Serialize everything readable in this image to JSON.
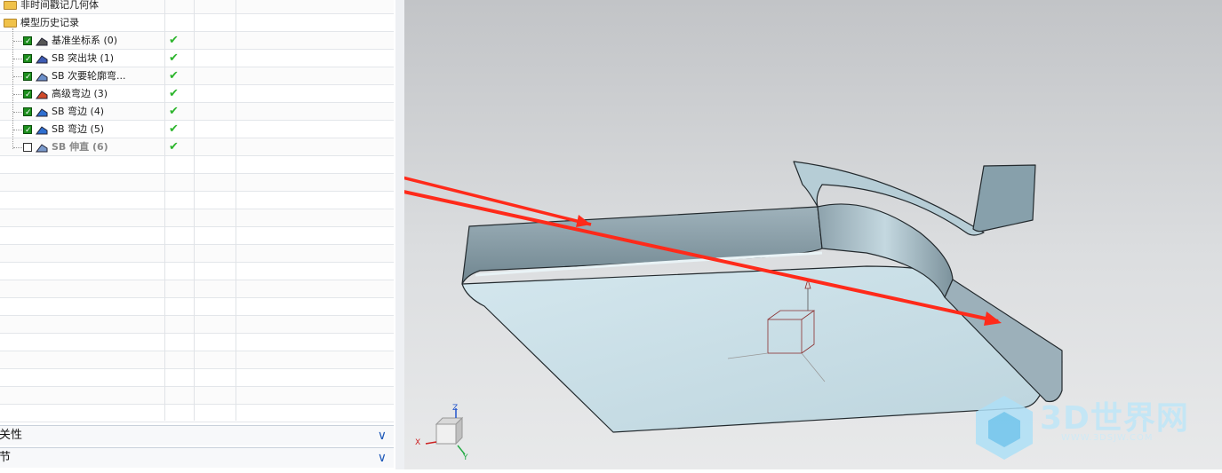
{
  "tree": {
    "items": [
      {
        "label": "非时间戳记几何体",
        "checked": null,
        "icon": "folder-icon",
        "status": ""
      },
      {
        "label": "模型历史记录",
        "checked": null,
        "icon": "folder-icon",
        "status": ""
      },
      {
        "label": "基准坐标系 (0)",
        "checked": true,
        "icon": "datum-csys-icon",
        "status": "✔"
      },
      {
        "label": "SB 突出块 (1)",
        "checked": true,
        "icon": "tab-feature-icon",
        "status": "✔"
      },
      {
        "label": "SB 次要轮廓弯...",
        "checked": true,
        "icon": "contour-flange-icon",
        "status": "✔"
      },
      {
        "label": "高级弯边 (3)",
        "checked": true,
        "icon": "advanced-flange-icon",
        "status": "✔"
      },
      {
        "label": "SB 弯边 (4)",
        "checked": true,
        "icon": "flange-icon",
        "status": "✔"
      },
      {
        "label": "SB 弯边 (5)",
        "checked": true,
        "icon": "flange-icon",
        "status": "✔"
      },
      {
        "label": "SB 伸直 (6)",
        "checked": false,
        "icon": "unbend-icon",
        "status": "✔"
      }
    ]
  },
  "panels": {
    "dependencies": "相关性",
    "details": "细节"
  },
  "viewport": {
    "axes": {
      "z": "Z",
      "x": "X",
      "y": "Y"
    },
    "watermark": {
      "brand": "3D世界网",
      "url": "WWW.3DSJW.COM"
    }
  },
  "colors": {
    "accent": "#1d58b8",
    "check": "#2db52d",
    "arrow": "#ff2a1a",
    "part_face": "#c6dde6",
    "part_edge": "#232a2e"
  }
}
